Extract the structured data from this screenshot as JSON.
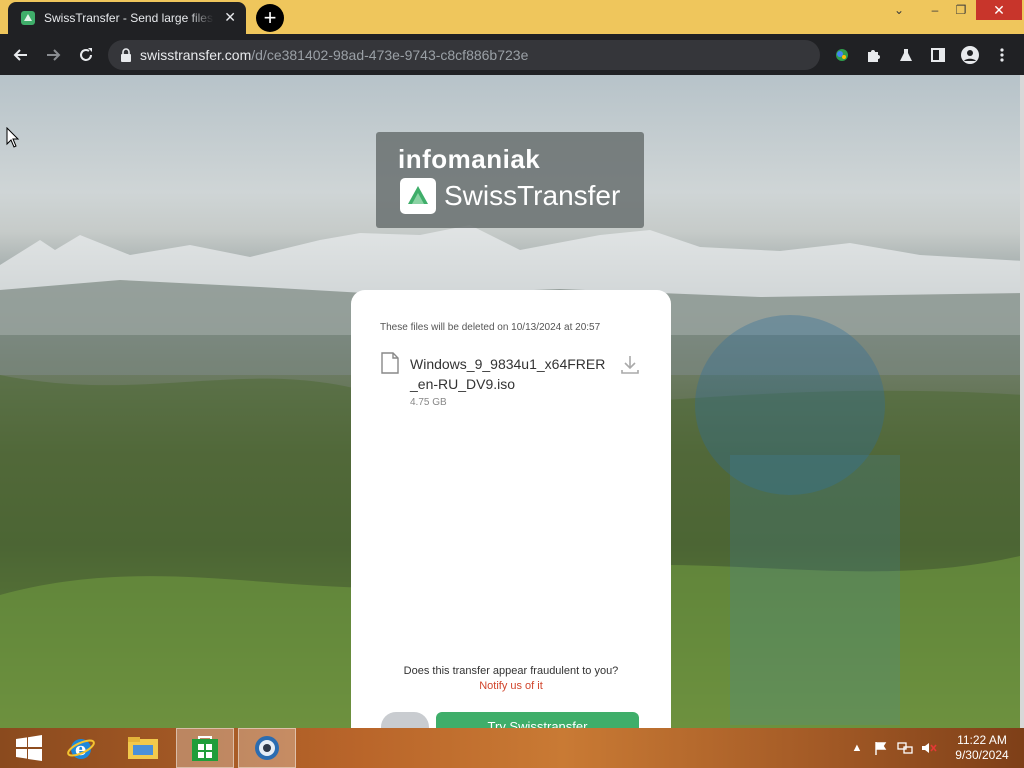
{
  "browser": {
    "tab_title": "SwissTransfer - Send large files securely",
    "url_host": "swisstransfer.com",
    "url_path": "/d/ce381402-98ad-473e-9743-c8cf886b723e",
    "close_glyph": "✕",
    "newtab_glyph": "+",
    "window_controls": {
      "minimize": "–",
      "restore": "❐",
      "close": "✕",
      "caret": "⌄"
    }
  },
  "brand": {
    "top": "infomaniak",
    "name": "SwissTransfer"
  },
  "transfer": {
    "expiry_text": "These files will be deleted on 10/13/2024 at 20:57",
    "file": {
      "name": "Windows_9_9834u1_x64FRER_en-RU_DV9.iso",
      "size": "4.75 GB"
    },
    "fraud_text": "Does this transfer appear fraudulent to you?",
    "fraud_link": "Notify us of it",
    "try_button": "Try Swisstransfer"
  },
  "taskbar": {
    "time": "11:22 AM",
    "date": "9/30/2024",
    "tray_caret": "▲"
  },
  "colors": {
    "titlebar": "#efc65c",
    "toolbar": "#202124",
    "accent_green": "#3fae6a",
    "link_red": "#d1452c"
  }
}
